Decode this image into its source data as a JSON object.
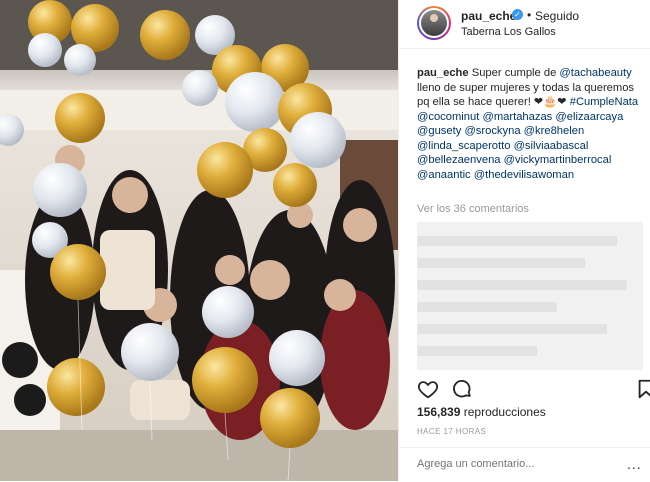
{
  "post": {
    "username": "pau_eche",
    "follow_separator": "•",
    "follow_status": "Seguido",
    "location": "Taberna Los Gallos"
  },
  "caption": {
    "author": "pau_eche",
    "segments": [
      {
        "t": "text",
        "v": " Super cumple de "
      },
      {
        "t": "tag",
        "v": "@tachabeauty"
      },
      {
        "t": "text",
        "v": " lleno de super mujeres y todas la queremos pq ella se hace querer! ❤🎂❤ "
      },
      {
        "t": "tag",
        "v": "#CumpleNata"
      },
      {
        "t": "text",
        "v": " "
      },
      {
        "t": "tag",
        "v": "@cocominut"
      },
      {
        "t": "text",
        "v": " "
      },
      {
        "t": "tag",
        "v": "@martahazas"
      },
      {
        "t": "text",
        "v": " "
      },
      {
        "t": "tag",
        "v": "@elizaarcaya"
      },
      {
        "t": "text",
        "v": " "
      },
      {
        "t": "tag",
        "v": "@gusety"
      },
      {
        "t": "text",
        "v": " "
      },
      {
        "t": "tag",
        "v": "@srockyna"
      },
      {
        "t": "text",
        "v": " "
      },
      {
        "t": "tag",
        "v": "@kre8helen"
      },
      {
        "t": "text",
        "v": " "
      },
      {
        "t": "tag",
        "v": "@linda_scaperotto"
      },
      {
        "t": "text",
        "v": " "
      },
      {
        "t": "tag",
        "v": "@silviaabascal"
      },
      {
        "t": "text",
        "v": " "
      },
      {
        "t": "tag",
        "v": "@bellezaenvena"
      },
      {
        "t": "text",
        "v": " "
      },
      {
        "t": "tag",
        "v": "@vickymartinberrocal"
      },
      {
        "t": "text",
        "v": " "
      },
      {
        "t": "tag",
        "v": "@anaantic"
      },
      {
        "t": "text",
        "v": " "
      },
      {
        "t": "tag",
        "v": "@thedevilisawoman"
      }
    ]
  },
  "comments": {
    "view_all": "Ver los 36 comentarios"
  },
  "stats": {
    "views_count": "156,839",
    "views_label": "reproducciones",
    "time_ago": "HACE 17 HORAS"
  },
  "icons": [
    "heart-icon",
    "comment-icon",
    "bookmark-icon",
    "more-options-icon",
    "verified-badge-icon"
  ],
  "comment_box": {
    "placeholder": "Agrega un comentario...",
    "more": "..."
  },
  "colors": {
    "link": "#003569",
    "verified": "#3897f0",
    "gold_balloon": "#d4a531",
    "silver_balloon": "#e8ecf1"
  }
}
